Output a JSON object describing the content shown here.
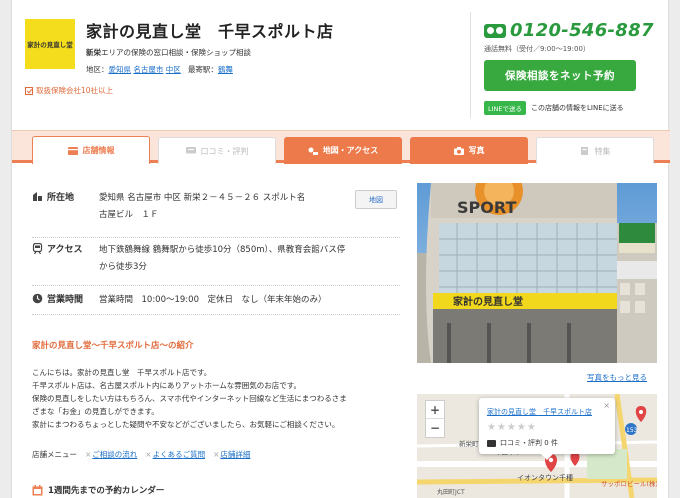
{
  "header": {
    "logo_text": "家計の見直し堂",
    "shop_name": "家計の見直し堂　千早スポルト店",
    "desc_strong": "新栄",
    "desc_rest": "エリアの保険の窓口相談・保険ショップ相談",
    "area_label": "地区：",
    "area_pref": "愛知県",
    "area_city": "名古屋市",
    "area_ward": "中区",
    "station_label": "最寄駅：",
    "station": "鶴舞",
    "insurers": "取扱保険会社10社以上",
    "phone": "0120-546-887",
    "phone_hours": "通話無料（受付／9:00〜19:00）",
    "reserve_button": "保険相談をネット予約",
    "line_badge": "LINEで送る",
    "line_text": "この店舗の情報をLINEに送る"
  },
  "tabs": [
    {
      "label": "店舗情報",
      "state": "active"
    },
    {
      "label": "口コミ・評判",
      "state": "disabled"
    },
    {
      "label": "地図・アクセス",
      "state": "orange"
    },
    {
      "label": "写真",
      "state": "orange"
    },
    {
      "label": "特集",
      "state": "disabled"
    }
  ],
  "info": {
    "address_label": "所在地",
    "address_line1": "愛知県 名古屋市 中区 新栄２－４５－２６ スポルト名",
    "address_line2": "古屋ビル　１Ｆ",
    "map_button": "地図",
    "access_label": "アクセス",
    "access_line1": "地下鉄鶴舞線 鶴舞駅から徒歩10分（850m）、県教育会館バス停",
    "access_line2": "から徒歩3分",
    "hours_label": "営業時間",
    "hours_value": "営業時間　10:00〜19:00　定休日　なし（年末年始のみ）"
  },
  "intro": {
    "title": "家計の見直し堂〜千早スポルト店〜の紹介",
    "lines": [
      "こんにちは。家計の見直し堂　千早スポルト店です。",
      "千早スポルト店は、名古屋スポルト内にありアットホームな雰囲気のお店です。",
      "保険の見直しをしたい方はもちろん、スマホ代やインターネット回線など生活にまつわるさま",
      "ざまな「お金」の見直しができます。",
      "家計にまつわるちょっとした疑問や不安などがございましたら、お気軽にご相談ください。"
    ]
  },
  "menu": {
    "label": "店舗メニュー",
    "links": [
      "ご相談の流れ",
      "よくあるご質問",
      "店舗詳細"
    ]
  },
  "calendar_title": "1週間先までの予約カレンダー",
  "photo": {
    "sign_text": "SPORT",
    "banner_text": "家計の見直し堂",
    "more_link": "写真をもっと見る"
  },
  "map": {
    "zoom_in": "+",
    "zoom_out": "−",
    "popup_title": "家計の見直し堂　千早スポルト店",
    "close": "×",
    "stars": "★★★★★",
    "reviews": "口コミ・評判 0 件",
    "label_station": "新栄町",
    "label_area": "中区千早",
    "label_road": "153",
    "label_jct": "丸田町JCT",
    "label_shop": "イオンタウン千種",
    "label_sapporo": "サッポロビール(株) 名"
  },
  "colors": {
    "accent": "#ee7f52",
    "green": "#37a93f",
    "link": "#1a6fc9"
  }
}
